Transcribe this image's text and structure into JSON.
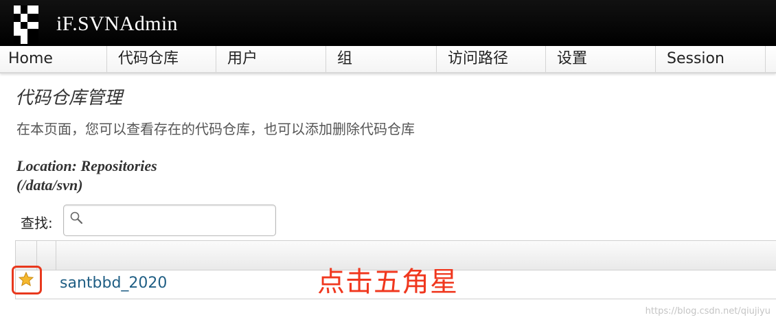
{
  "header": {
    "app_title": "iF.SVNAdmin",
    "logo_icon": "svnadmin-logo-icon"
  },
  "nav": {
    "items": [
      {
        "label": "Home"
      },
      {
        "label": "代码仓库"
      },
      {
        "label": "用户"
      },
      {
        "label": "组"
      },
      {
        "label": "访问路径"
      },
      {
        "label": "设置"
      },
      {
        "label": "Session"
      }
    ]
  },
  "page": {
    "title": "代码仓库管理",
    "description": "在本页面，您可以查看存在的代码仓库，也可以添加删除代码仓库",
    "location_line1": "Location: Repositories",
    "location_line2": "(/data/svn)"
  },
  "search": {
    "label": "查找:",
    "value": "",
    "placeholder": "",
    "icon": "search-icon"
  },
  "repositories": [
    {
      "name": "santbbd_2020",
      "icon": "star-icon"
    }
  ],
  "annotation": "点击五角星",
  "watermark": "https://blog.csdn.net/qiujiyu",
  "colors": {
    "header_bg": "#000000",
    "link": "#1f5e84",
    "annotation": "#f0371e",
    "highlight_border": "#e8381d",
    "star": "#f5b82e"
  }
}
